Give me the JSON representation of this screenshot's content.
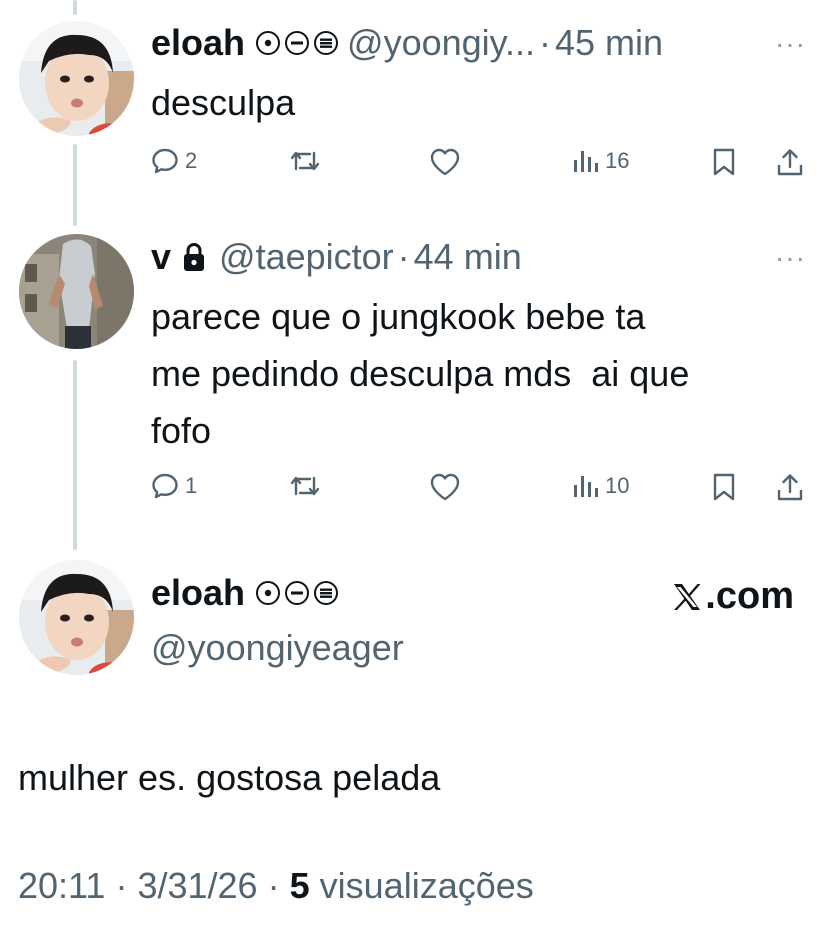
{
  "tweets": [
    {
      "name": "eloah",
      "handle": "@yoongiy...",
      "time": "45 min",
      "text": "desculpa",
      "replies": "2",
      "views": "16"
    },
    {
      "name": "v",
      "handle": "@taepictor",
      "time": "44 min",
      "text_lines": [
        "parece que o jungkook bebe ta",
        "me pedindo desculpa mds  ai que",
        "fofo"
      ],
      "replies": "1",
      "views": "10"
    }
  ],
  "main": {
    "name": "eloah",
    "handle": "@yoongiyeager",
    "text": "mulher es. gostosa pelada",
    "time": "20:11",
    "date": "3/31/26",
    "views_count": "5",
    "views_label": "visualizações"
  },
  "brand": ".com",
  "separator": "·",
  "more": "···",
  "icons": {
    "reply": "reply-icon",
    "retweet": "retweet-icon",
    "like": "heart-icon",
    "views": "views-icon",
    "bookmark": "bookmark-icon",
    "share": "share-icon",
    "lock": "lock-icon",
    "badges": "status-badges-icon",
    "x": "x-logo-icon"
  },
  "colors": {
    "text": "#0f1419",
    "secondary": "#536471",
    "thread": "#cfd9de"
  }
}
